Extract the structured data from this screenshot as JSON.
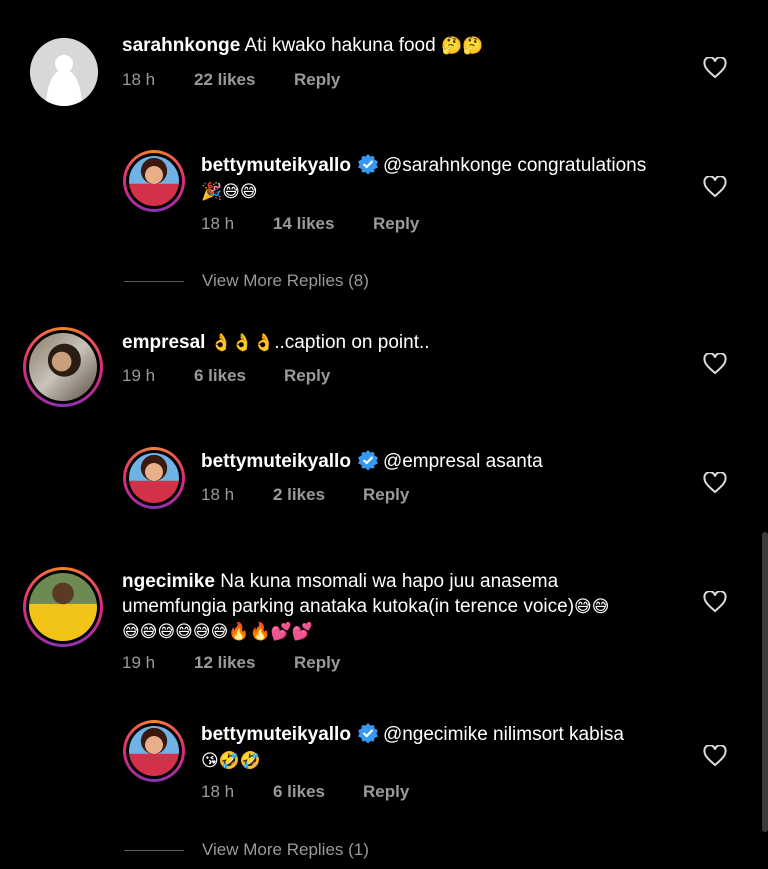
{
  "comments": [
    {
      "user": "sarahnkonge",
      "text": "Ati kwako hakuna food",
      "emoji": "🤔🤔",
      "time": "18 h",
      "likes": "22 likes",
      "reply": "Reply",
      "avatar": "default-avatar"
    },
    {
      "user": "bettymuteikyallo",
      "text": "@sarahnkonge congratulations",
      "emoji2": "🎉😅😅",
      "time": "18 h",
      "likes": "14 likes",
      "reply": "Reply",
      "avatar": "betty-avatar"
    },
    {
      "view_more": "View More Replies (8)"
    },
    {
      "user": "empresal",
      "emoji": "👌👌👌",
      "text": "..caption on point..",
      "time": "19 h",
      "likes": "6 likes",
      "reply": "Reply",
      "avatar": "empresal-avatar"
    },
    {
      "user": "bettymuteikyallo",
      "text": "@empresal asanta",
      "time": "18 h",
      "likes": "2 likes",
      "reply": "Reply",
      "avatar": "betty-avatar"
    },
    {
      "user": "ngecimike",
      "text1": "Na kuna msomali wa hapo juu anasema",
      "text2": "umemfungia parking anataka kutoka(in terence voice)",
      "emoji_end": "😅😅",
      "emoji3": "😅😅😅😅😅😅🔥🔥💕💕",
      "time": "19 h",
      "likes": "12 likes",
      "reply": "Reply",
      "avatar": "ngecimike-avatar"
    },
    {
      "user": "bettymuteikyallo",
      "text": "@ngecimike nilimsort kabisa",
      "emoji2": "😘🤣🤣",
      "time": "18 h",
      "likes": "6 likes",
      "reply": "Reply",
      "avatar": "betty-avatar"
    },
    {
      "view_more": "View More Replies (1)"
    }
  ],
  "icons": {
    "heart": "heart-outline-icon",
    "verified": "verified-badge-icon"
  },
  "colors": {
    "background": "#000000",
    "verified": "#3897f0",
    "secondary_text": "#9a9a9a"
  }
}
